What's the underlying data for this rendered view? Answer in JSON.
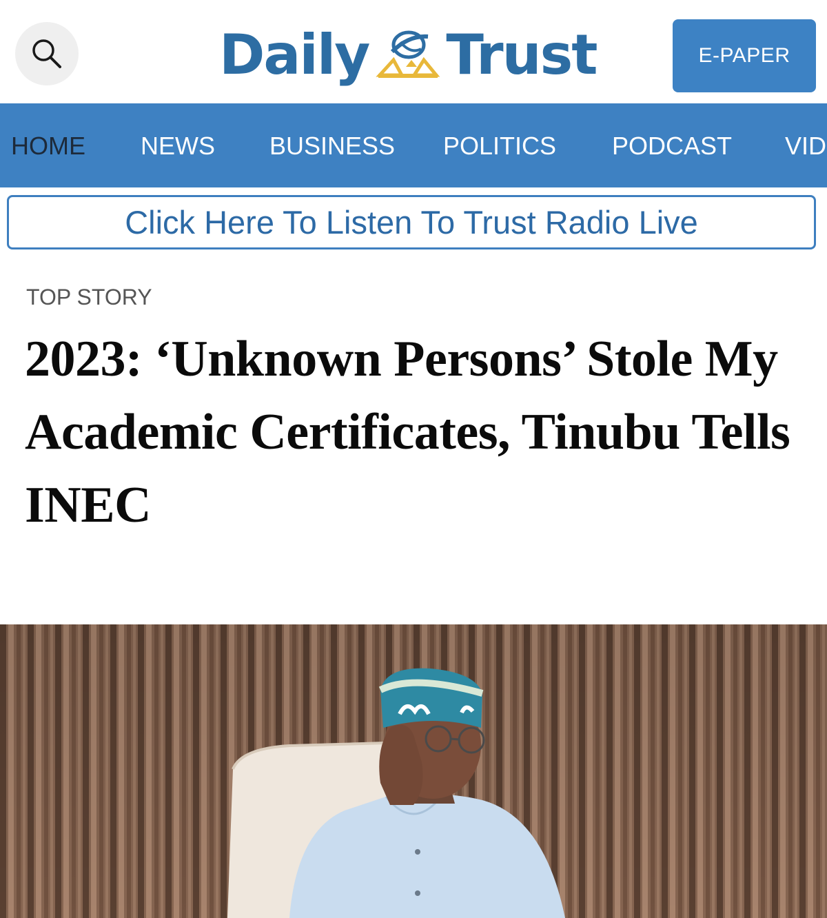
{
  "header": {
    "logo": {
      "left": "Daily",
      "right": "Trust"
    },
    "epaper_label": "E-PAPER",
    "search_icon": "search-icon",
    "colors": {
      "brand_blue": "#2d6da3",
      "emblem_gold": "#e8b83a"
    }
  },
  "nav": {
    "items": [
      {
        "label": "HOME",
        "active": true
      },
      {
        "label": "NEWS"
      },
      {
        "label": "BUSINESS"
      },
      {
        "label": "POLITICS"
      },
      {
        "label": "PODCAST"
      },
      {
        "label": "VID"
      }
    ],
    "color": "#3e81c2"
  },
  "radio_banner": {
    "label": "Click Here To Listen To Trust Radio Live"
  },
  "article": {
    "kicker": "TOP STORY",
    "headline": "2023: ‘Unknown Persons’ Stole My Academic Certificates, Tinubu Tells INEC"
  }
}
